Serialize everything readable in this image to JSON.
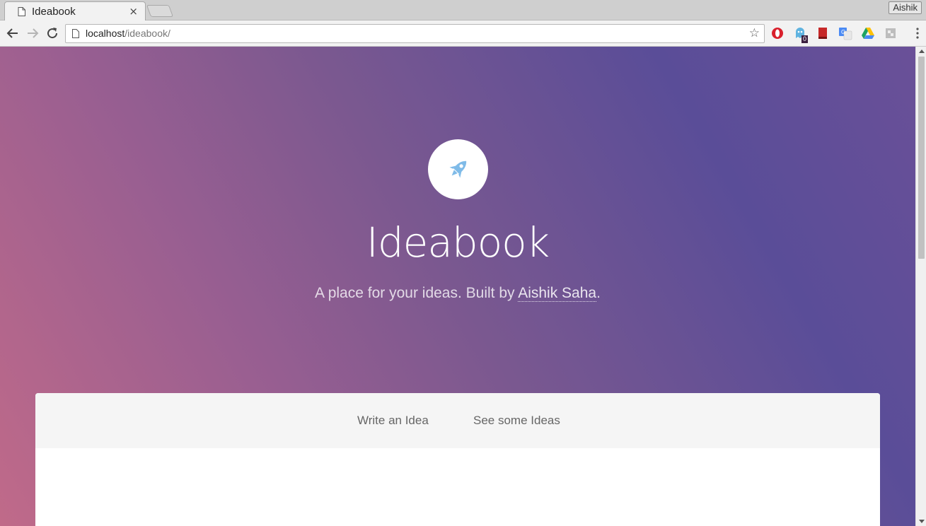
{
  "browser": {
    "tab_title": "Ideabook",
    "close_glyph": "×",
    "profile_name": "Aishik",
    "url_host": "localhost",
    "url_path": "/ideabook/",
    "bookmark_glyph": "☆",
    "extension_badge": "0"
  },
  "hero": {
    "title": "Ideabook",
    "subtitle_prefix": "A place for your ideas. Built by ",
    "author": "Aishik Saha",
    "subtitle_suffix": ".",
    "icon": "rocket-icon"
  },
  "nav": {
    "write_label": "Write an Idea",
    "see_label": "See some Ideas"
  },
  "colors": {
    "rocket": "#7fbbe8",
    "gradient_left": "#c06a89",
    "gradient_right": "#5a4d98"
  }
}
